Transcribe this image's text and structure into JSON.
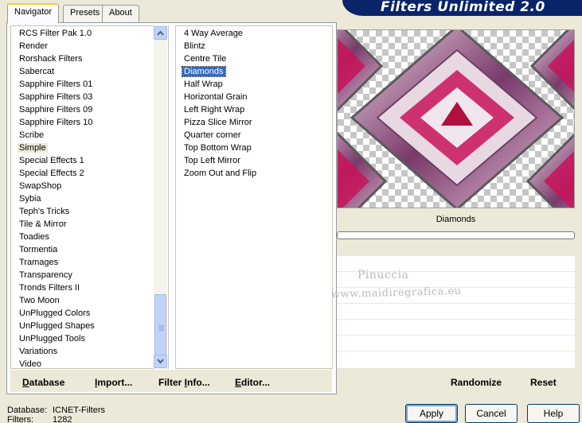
{
  "tabs": [
    "Navigator",
    "Presets",
    "About"
  ],
  "app_title": "Filters Unlimited 2.0",
  "categories": [
    "RCS Filter Pak 1.0",
    "Render",
    "Rorshack Filters",
    "Sabercat",
    "Sapphire Filters 01",
    "Sapphire Filters 03",
    "Sapphire Filters 09",
    "Sapphire Filters 10",
    "Scribe",
    "Simple",
    "Special Effects 1",
    "Special Effects 2",
    "SwapShop",
    "Sybia",
    "Teph's Tricks",
    "Tile & Mirror",
    "Toadies",
    "Tormentia",
    "Tramages",
    "Transparency",
    "Tronds Filters II",
    "Two Moon",
    "UnPlugged Colors",
    "UnPlugged Shapes",
    "UnPlugged Tools",
    "Variations",
    "Video"
  ],
  "highlighted_category": "Simple",
  "filters": [
    "4 Way Average",
    "Blintz",
    "Centre Tile",
    "Diamonds",
    "Half Wrap",
    "Horizontal Grain",
    "Left Right Wrap",
    "Pizza Slice Mirror",
    "Quarter corner",
    "Top Bottom Wrap",
    "Top Left Mirror",
    "Zoom Out and Flip"
  ],
  "selected_filter": "Diamonds",
  "left_buttons": {
    "database": {
      "hot": "D",
      "rest": "atabase"
    },
    "import": {
      "hot": "I",
      "rest": "mport..."
    },
    "filter_info": {
      "pre": "Filter ",
      "hot": "I",
      "rest": "nfo..."
    },
    "editor": {
      "hot": "E",
      "rest": "ditor..."
    }
  },
  "preview_filter_name": "Diamonds",
  "watermark": {
    "line1": "Pinuccia",
    "line2": "www.maidiregrafica.eu"
  },
  "right_buttons": {
    "randomize": "Randomize",
    "reset": "Reset"
  },
  "info": {
    "database_label": "Database:",
    "database_value": "ICNET-Filters",
    "filters_label": "Filters:",
    "filters_value": "1282"
  },
  "dialog_buttons": {
    "apply": "Apply",
    "cancel": "Cancel",
    "help": "Help"
  },
  "colors": {
    "accent": "#316ac5",
    "banner": "#0a246a",
    "magenta": "#c8145a"
  }
}
